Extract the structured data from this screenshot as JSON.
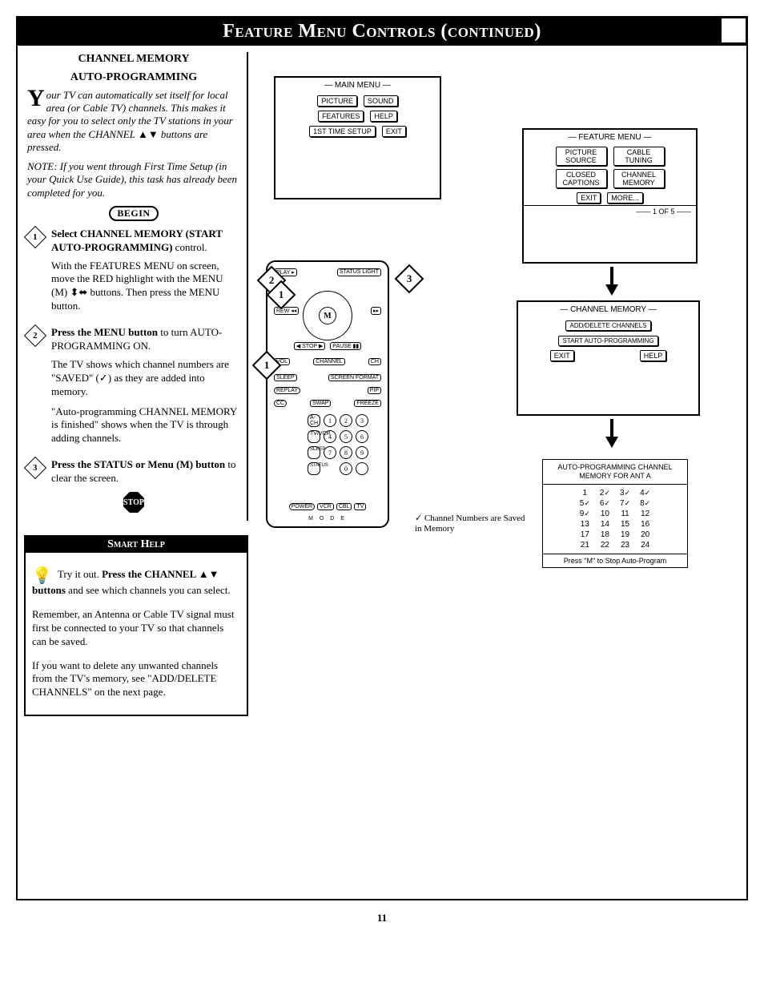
{
  "page": {
    "title": "Feature Menu Controls (continued)",
    "number": "11"
  },
  "left": {
    "heading1": "CHANNEL MEMORY",
    "heading2": "AUTO-PROGRAMMING",
    "intro_dropcap": "Y",
    "intro_rest": "our TV can automatically set itself for local area (or Cable TV) channels. This makes it easy for you to select only the TV stations in your area when the CHANNEL ▲▼ buttons are pressed.",
    "note": "NOTE: If you went through First Time Setup (in your Quick Use Guide), this task has already been completed for you.",
    "begin": "BEGIN",
    "step1_bold": "Select CHANNEL MEMORY (START AUTO-PROGRAMMING)",
    "step1_tail": " control.",
    "step1_para": "With the FEATURES MENU on screen, move the RED highlight with the MENU (M) ⬍⬌ buttons. Then press the MENU button.",
    "step2_bold": "Press the MENU button",
    "step2_tail": " to turn AUTO-PROGRAMMING ON.",
    "step2_para1": "The TV shows which channel numbers are \"SAVED\" (✓) as they are added into memory.",
    "step2_para2": "\"Auto-programming CHANNEL MEMORY is finished\" shows when the TV is through adding channels.",
    "step3_bold": "Press the STATUS or Menu (M) button",
    "step3_tail": " to clear the screen.",
    "stop": "STOP"
  },
  "smart": {
    "title": "Smart Help",
    "p1a": "Try it out. ",
    "p1b": "Press the CHANNEL ▲▼ buttons",
    "p1c": " and see which channels you can select.",
    "p2": "Remember, an Antenna or Cable TV signal must first be connected to your TV so that channels can be saved.",
    "p3": "If you want to delete any unwanted channels from the TV's memory, see \"ADD/DELETE CHANNELS\" on the next page."
  },
  "mainmenu": {
    "title": "MAIN MENU",
    "items": [
      "PICTURE",
      "SOUND",
      "FEATURES",
      "HELP",
      "1ST TIME SETUP",
      "EXIT"
    ]
  },
  "featuremenu": {
    "title": "FEATURE MENU",
    "items": [
      "PICTURE SOURCE",
      "CABLE TUNING",
      "CLOSED CAPTIONS",
      "CHANNEL MEMORY",
      "EXIT",
      "MORE..."
    ],
    "pager": "1 OF 5"
  },
  "chmemmenu": {
    "title": "CHANNEL MEMORY",
    "items": [
      "ADD/DELETE CHANNELS",
      "START AUTO-PROGRAMMING",
      "EXIT",
      "HELP"
    ]
  },
  "remote": {
    "top": [
      "PLAY ▸",
      "STATUS LIGHT"
    ],
    "mid": [
      "REW ◂◂",
      "",
      "▸▸"
    ],
    "below": [
      "◀ STOP ▶",
      "PAUSE ▮▮"
    ],
    "vcr": [
      "VOL",
      "CHANNEL",
      "CH"
    ],
    "row2": [
      "SLEEP",
      "SCREEN FORMAT"
    ],
    "row3": [
      "REPLAY",
      "PIP"
    ],
    "row4": [
      "CC",
      "SWAP",
      "FREEZE"
    ],
    "row5": [
      "A-CH",
      "TV/VCR"
    ],
    "bottom": [
      "POWER",
      "VCR",
      "CBL",
      "TV"
    ],
    "modelabel": "M  O  D  E",
    "keys": [
      "1",
      "2",
      "3",
      "4",
      "5",
      "6",
      "7",
      "8",
      "9",
      "0"
    ]
  },
  "chnote": "✓ Channel Numbers are Saved in Memory",
  "chart_data": {
    "type": "table",
    "title": "AUTO-PROGRAMMING CHANNEL MEMORY FOR ANT A",
    "columns": [
      "ch",
      "saved"
    ],
    "rows": [
      {
        "ch": 1,
        "saved": false
      },
      {
        "ch": 2,
        "saved": true
      },
      {
        "ch": 3,
        "saved": true
      },
      {
        "ch": 4,
        "saved": true
      },
      {
        "ch": 5,
        "saved": true
      },
      {
        "ch": 6,
        "saved": true
      },
      {
        "ch": 7,
        "saved": true
      },
      {
        "ch": 8,
        "saved": true
      },
      {
        "ch": 9,
        "saved": true
      },
      {
        "ch": 10,
        "saved": false
      },
      {
        "ch": 11,
        "saved": false
      },
      {
        "ch": 12,
        "saved": false
      },
      {
        "ch": 13,
        "saved": false
      },
      {
        "ch": 14,
        "saved": false
      },
      {
        "ch": 15,
        "saved": false
      },
      {
        "ch": 16,
        "saved": false
      },
      {
        "ch": 17,
        "saved": false
      },
      {
        "ch": 18,
        "saved": false
      },
      {
        "ch": 19,
        "saved": false
      },
      {
        "ch": 20,
        "saved": false
      },
      {
        "ch": 21,
        "saved": false
      },
      {
        "ch": 22,
        "saved": false
      },
      {
        "ch": 23,
        "saved": false
      },
      {
        "ch": 24,
        "saved": false
      }
    ],
    "footer": "Press \"M\" to Stop Auto-Program"
  }
}
